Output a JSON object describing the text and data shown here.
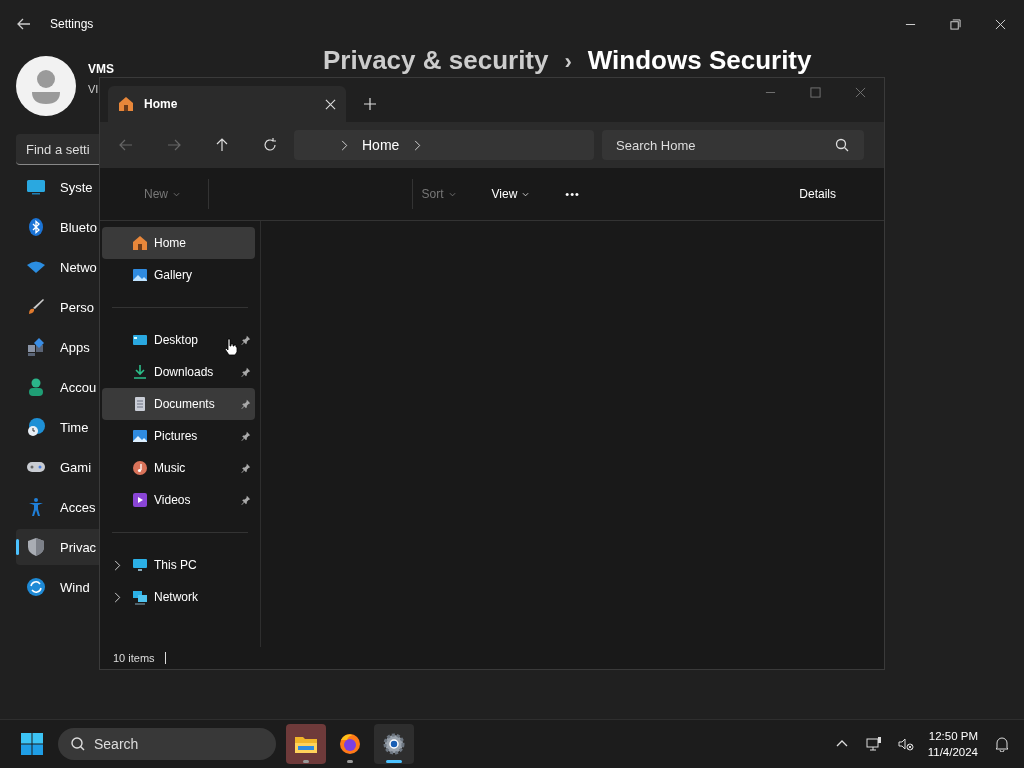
{
  "settings": {
    "title": "Settings",
    "user": {
      "name": "VMS",
      "detail": "VI"
    },
    "search": {
      "placeholder": "Find a setti"
    },
    "nav": [
      {
        "kind": "system",
        "label": "Syste",
        "selected": false
      },
      {
        "kind": "bluetooth",
        "label": "Blueto",
        "selected": false
      },
      {
        "kind": "network",
        "label": "Netwo",
        "selected": false
      },
      {
        "kind": "personalization",
        "label": "Perso",
        "selected": false
      },
      {
        "kind": "apps",
        "label": "Apps",
        "selected": false
      },
      {
        "kind": "accounts",
        "label": "Accou",
        "selected": false
      },
      {
        "kind": "time",
        "label": "Time",
        "selected": false
      },
      {
        "kind": "gaming",
        "label": "Gami",
        "selected": false
      },
      {
        "kind": "accessibility",
        "label": "Acces",
        "selected": false
      },
      {
        "kind": "privacy",
        "label": "Privac",
        "selected": true
      },
      {
        "kind": "update",
        "label": "Wind",
        "selected": false
      }
    ],
    "header": {
      "parent": "Privacy & security",
      "separator": "›",
      "current": "Windows Security"
    }
  },
  "explorer": {
    "tabs": [
      {
        "label": "Home",
        "selected": true
      }
    ],
    "address": {
      "segments": [
        "Home"
      ]
    },
    "search": {
      "placeholder": "Search Home"
    },
    "toolbar": [
      {
        "kind": "new",
        "label": "New",
        "disabled": true
      },
      {
        "kind": "sort",
        "label": "Sort",
        "disabled": true
      },
      {
        "kind": "view",
        "label": "View",
        "disabled": false
      },
      {
        "kind": "more",
        "label": "•••",
        "disabled": false
      },
      {
        "kind": "details",
        "label": "Details",
        "disabled": false
      }
    ],
    "sidebar": [
      [
        {
          "kind": "home",
          "label": "Home",
          "selected": true
        },
        {
          "kind": "gallery",
          "label": "Gallery",
          "selected": false
        }
      ],
      [
        {
          "kind": "desktop",
          "label": "Desktop",
          "selected": false,
          "pinned": true
        },
        {
          "kind": "downloads",
          "label": "Downloads",
          "selected": false,
          "pinned": true
        },
        {
          "kind": "documents",
          "label": "Documents",
          "selected": true,
          "pinned": true
        },
        {
          "kind": "pictures",
          "label": "Pictures",
          "selected": false,
          "pinned": true
        },
        {
          "kind": "music",
          "label": "Music",
          "selected": false,
          "pinned": true
        },
        {
          "kind": "videos",
          "label": "Videos",
          "selected": false,
          "pinned": true
        }
      ],
      [
        {
          "kind": "pc",
          "label": "This PC",
          "selected": false,
          "expanded": false
        },
        {
          "kind": "network",
          "label": "Network",
          "selected": false,
          "expanded": false
        }
      ]
    ],
    "status": "10 items"
  },
  "taskbar": {
    "search": {
      "placeholder": "Search"
    },
    "apps": [
      {
        "kind": "explorer",
        "active": false,
        "running": true
      },
      {
        "kind": "browser",
        "active": false,
        "running": true
      },
      {
        "kind": "settings",
        "active": true,
        "running": true
      }
    ],
    "time": "12:50 PM",
    "date": "11/4/2024"
  }
}
